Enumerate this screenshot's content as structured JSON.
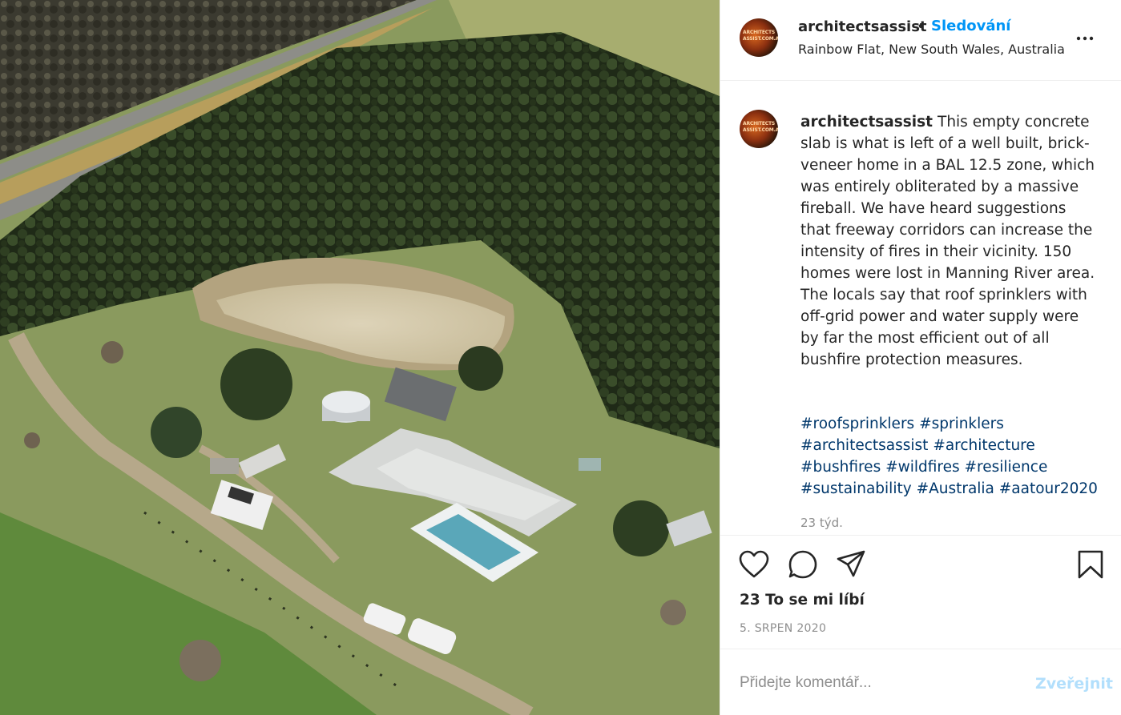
{
  "photo": {
    "description_icon": "aerial-photo-icon"
  },
  "header": {
    "avatar_text": [
      "ARCHITECTS",
      "ASSIST.COM.AU"
    ],
    "username": "architectsassist",
    "dot": "•",
    "follow_label": "Sledování",
    "location": "Rainbow Flat, New South Wales, Australia",
    "more_icon": "more-options-icon"
  },
  "caption": {
    "username": "architectsassist",
    "text": "This empty concrete slab is what is left of a well built, brick-veneer home in a BAL 12.5 zone, which was entirely obliterated by a massive fireball. We have heard suggestions that freeway corridors can increase the intensity of fires in their vicinity. 150 homes were lost in Manning River area. The locals say that roof sprinklers with off-grid power and water supply were by far the most efficient out of all bushfire protection measures.",
    "hashtags": [
      "#roofsprinklers",
      "#sprinklers",
      "#architectsassist",
      "#architecture",
      "#bushfires",
      "#wildfires",
      "#resilience",
      "#sustainability",
      "#Australia",
      "#aatour2020"
    ],
    "time_ago": "23 týd."
  },
  "actions": {
    "like_icon": "heart-icon",
    "comment_icon": "comment-icon",
    "share_icon": "share-icon",
    "save_icon": "bookmark-icon",
    "likes_label": "23 To se mi líbí",
    "date": "5. SRPEN 2020"
  },
  "comment": {
    "placeholder": "Přidejte komentář...",
    "post_label": "Zveřejnit",
    "post_color": "#b2dffc"
  },
  "colors": {
    "link": "#0095f6",
    "hashtag": "#00376b",
    "muted": "#8e8e8e"
  }
}
